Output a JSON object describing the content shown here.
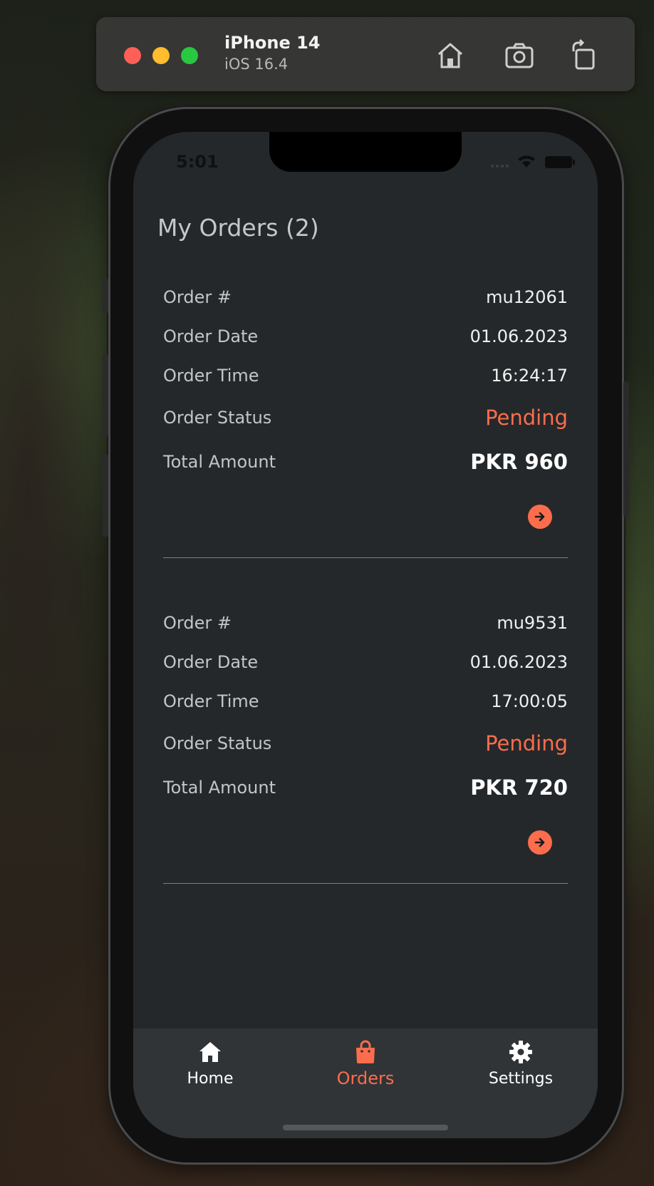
{
  "simulator": {
    "device_name": "iPhone 14",
    "os_version": "iOS 16.4",
    "buttons": [
      "home-icon",
      "screenshot-icon",
      "rotate-icon"
    ]
  },
  "status_bar": {
    "time": "5:01"
  },
  "page": {
    "title": "My Orders (2)"
  },
  "orders": [
    {
      "order_number_label": "Order #",
      "order_number": "mu12061",
      "date_label": "Order Date",
      "date": "01.06.2023",
      "time_label": "Order Time",
      "time": "16:24:17",
      "status_label": "Order Status",
      "status": "Pending",
      "amount_label": "Total Amount",
      "amount": "PKR 960"
    },
    {
      "order_number_label": "Order #",
      "order_number": "mu9531",
      "date_label": "Order Date",
      "date": "01.06.2023",
      "time_label": "Order Time",
      "time": "17:00:05",
      "status_label": "Order Status",
      "status": "Pending",
      "amount_label": "Total Amount",
      "amount": "PKR 720"
    }
  ],
  "tabbar": {
    "items": [
      {
        "label": "Home",
        "icon": "home-icon"
      },
      {
        "label": "Orders",
        "icon": "shopping-bag-icon",
        "active": true
      },
      {
        "label": "Settings",
        "icon": "gear-icon"
      }
    ]
  },
  "colors": {
    "accent": "#fb6d4c",
    "screen_background": "#25282a",
    "tabbar_background": "#303437",
    "label_text": "#c3c5c7"
  }
}
